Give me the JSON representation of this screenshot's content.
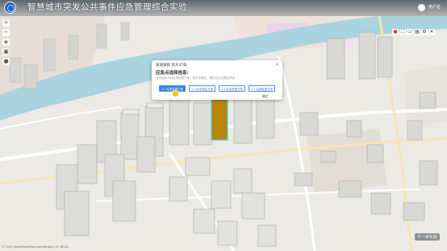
{
  "header": {
    "title": "智慧城市突发公共事件应急管理综合实验",
    "user_name": "用户名",
    "accent_color": "#1f63c4"
  },
  "left_toolbar": {
    "items": [
      {
        "icon": "plus-icon",
        "glyph": "+"
      },
      {
        "icon": "minus-icon",
        "glyph": "−"
      },
      {
        "icon": "compass-icon",
        "glyph": "◈"
      },
      {
        "icon": "layer-icon",
        "glyph": "▣"
      },
      {
        "icon": "location-icon",
        "glyph": "●"
      }
    ]
  },
  "right_toolbar": {
    "items": [
      {
        "icon": "record-icon",
        "glyph": "●"
      },
      {
        "icon": "fullscreen-icon",
        "glyph": "⛶"
      },
      {
        "icon": "measure-icon",
        "glyph": "▭"
      },
      {
        "icon": "layers-icon",
        "glyph": "▤"
      },
      {
        "icon": "settings-icon",
        "glyph": "⚙"
      },
      {
        "icon": "close-icon",
        "glyph": "✕"
      }
    ]
  },
  "dialog": {
    "title": "某城某街 高大47栋",
    "close_glyph": "×",
    "heading": "应急点选择信息:",
    "hint": "请先选择下列应急处置方案，再点击确定，确定后点击确定按钮",
    "options": [
      {
        "label": "2.2 应急处置方案",
        "selected": true
      },
      {
        "label": "2.3 信息报送方案",
        "selected": false
      },
      {
        "label": "2.4 应急救援方案",
        "selected": false
      },
      {
        "label": "2.5 后期处置方案",
        "selected": false
      }
    ],
    "confirm_label": "确定"
  },
  "map": {
    "river_color": "#aad3df",
    "highlight_color": "#b8860b",
    "highlight_outline": "#3fd6e8"
  },
  "footer": {
    "attribution": "© 2021 OpenStreetMap contributors, CC BY-SA"
  },
  "next_button": {
    "label": "下一步实验"
  }
}
